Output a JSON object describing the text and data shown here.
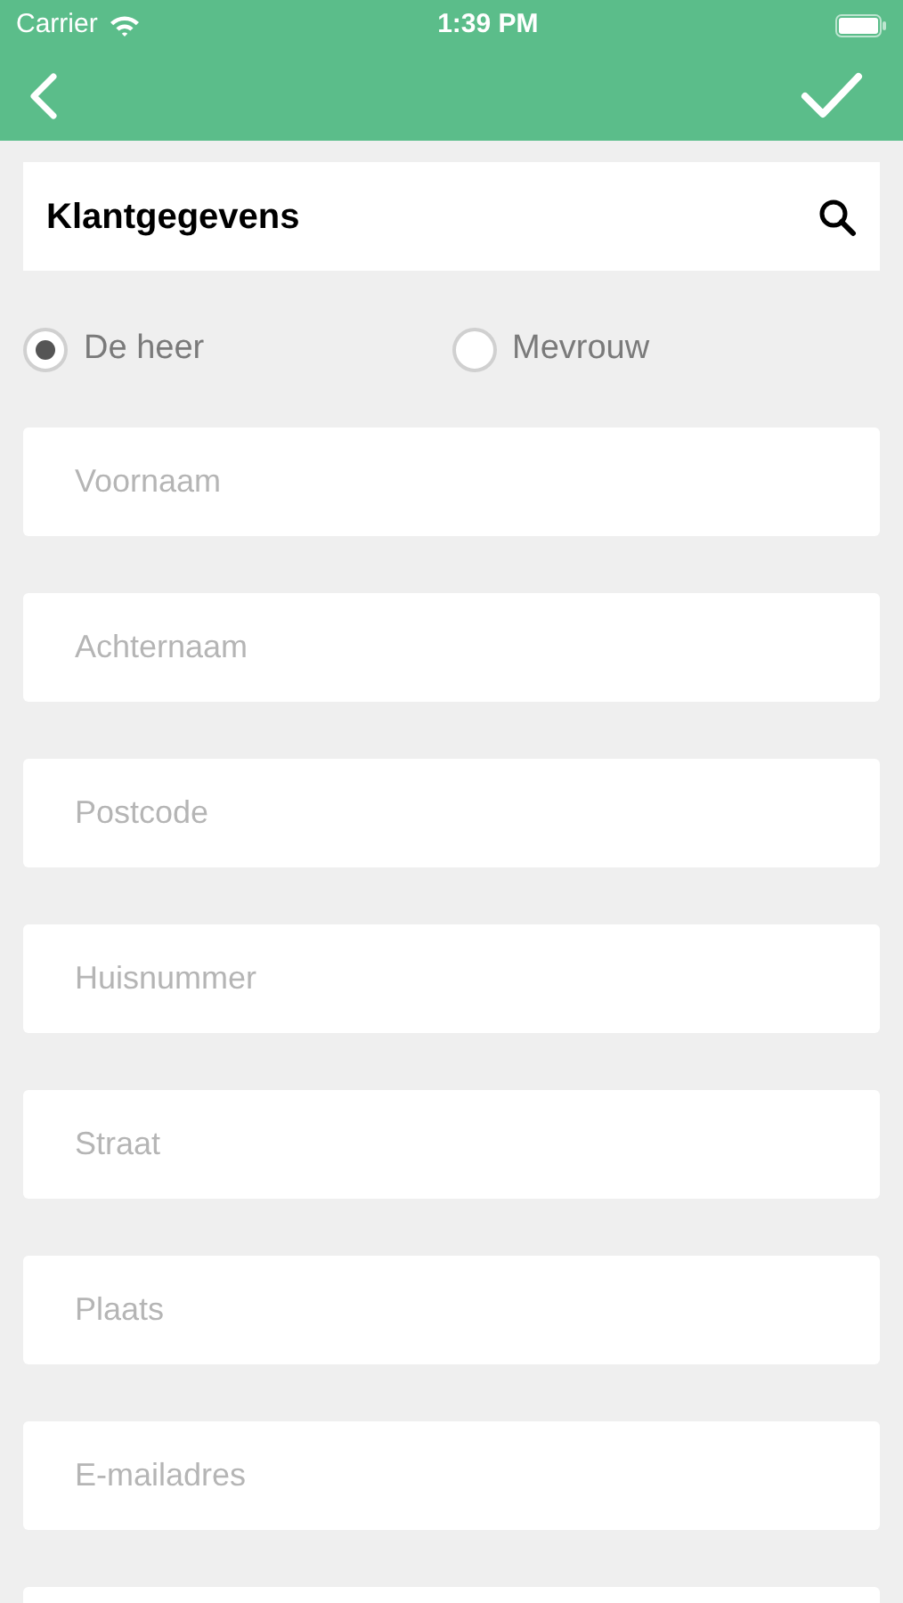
{
  "status_bar": {
    "carrier": "Carrier",
    "time": "1:39 PM"
  },
  "header": {
    "title": "Klantgegevens"
  },
  "salutation": [
    {
      "label": "De heer",
      "selected": true
    },
    {
      "label": "Mevrouw",
      "selected": false
    }
  ],
  "fields": [
    {
      "kind": "text",
      "placeholder": "Voornaam"
    },
    {
      "kind": "text",
      "placeholder": "Achternaam"
    },
    {
      "kind": "text",
      "placeholder": "Postcode"
    },
    {
      "kind": "text",
      "placeholder": "Huisnummer"
    },
    {
      "kind": "text",
      "placeholder": "Straat"
    },
    {
      "kind": "text",
      "placeholder": "Plaats"
    },
    {
      "kind": "text",
      "placeholder": "E-mailadres"
    },
    {
      "kind": "partial"
    }
  ]
}
